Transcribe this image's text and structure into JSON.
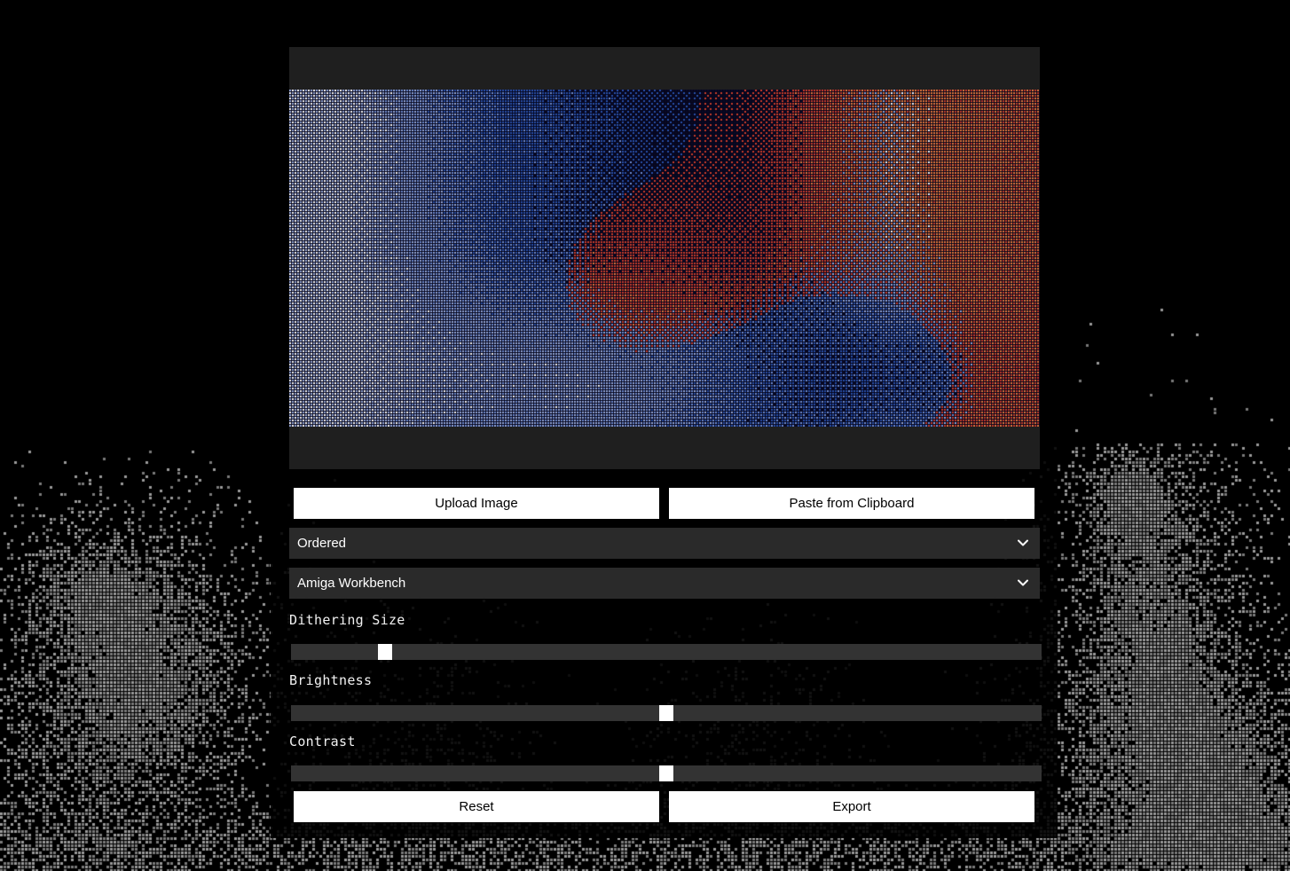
{
  "buttons": {
    "upload": "Upload Image",
    "paste": "Paste from Clipboard",
    "reset": "Reset",
    "export": "Export"
  },
  "selects": {
    "algorithm": {
      "value": "Ordered"
    },
    "palette": {
      "value": "Amiga Workbench"
    }
  },
  "sliders": [
    {
      "label": "Dithering Size",
      "value": 0.118
    },
    {
      "label": "Brightness",
      "value": 0.5
    },
    {
      "label": "Contrast",
      "value": 0.5
    }
  ],
  "icons": {
    "algorithm_chevron": "chevron-down-icon",
    "palette_chevron": "chevron-down-icon"
  },
  "colors": {
    "background": "#000000",
    "preview_frame": "#1f1f1f",
    "select_bg": "#2a2a2a",
    "track_bg": "#333333",
    "button_bg": "#ffffff",
    "palette": [
      "#ffffff",
      "#1d3f8f",
      "#0a0a2a",
      "#c43a2a",
      "#e8783a",
      "#6a8ad0"
    ]
  }
}
